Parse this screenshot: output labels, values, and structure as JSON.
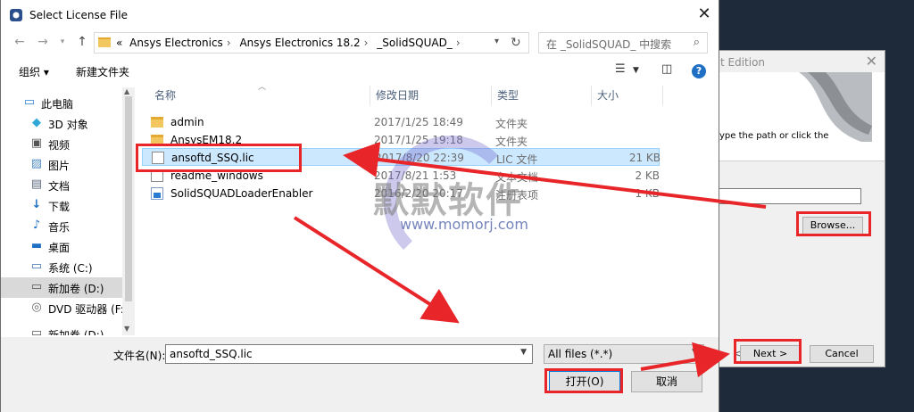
{
  "background_window": {
    "title": "t Edition",
    "instruction": "y type the path or click the",
    "browse_label": "Browse...",
    "back_glyph": "<",
    "next_label": "Next >",
    "cancel_label": "Cancel"
  },
  "dialog": {
    "title": "Select License File",
    "address": {
      "prefix": "«",
      "crumbs": [
        "Ansys Electronics",
        "Ansys Electronics 18.2",
        "_SolidSQUAD_"
      ]
    },
    "search_placeholder": "在 _SolidSQUAD_ 中搜索",
    "toolbar": {
      "organize": "组织 ▾",
      "new_folder": "新建文件夹"
    },
    "nav_tree": [
      {
        "label": "此电脑",
        "icon": "computer-icon",
        "glyph": "▭",
        "top": true
      },
      {
        "label": "3D 对象",
        "icon": "cube-icon",
        "glyph": "◆"
      },
      {
        "label": "视频",
        "icon": "video-icon",
        "glyph": "▣"
      },
      {
        "label": "图片",
        "icon": "picture-icon",
        "glyph": "▨"
      },
      {
        "label": "文档",
        "icon": "document-icon",
        "glyph": "▤"
      },
      {
        "label": "下载",
        "icon": "download-icon",
        "glyph": "↓"
      },
      {
        "label": "音乐",
        "icon": "music-icon",
        "glyph": "♪"
      },
      {
        "label": "桌面",
        "icon": "desktop-icon",
        "glyph": "▬"
      },
      {
        "label": "系统 (C:)",
        "icon": "drive-icon",
        "glyph": "▭"
      },
      {
        "label": "新加卷 (D:)",
        "icon": "drive-icon",
        "glyph": "▭",
        "selected": true
      },
      {
        "label": "DVD 驱动器 (F:)",
        "icon": "dvd-icon",
        "glyph": "◎"
      },
      {
        "label": "新加卷 (D:)",
        "icon": "drive-icon",
        "glyph": "▭"
      }
    ],
    "columns": [
      "名称",
      "修改日期",
      "类型",
      "大小"
    ],
    "files": [
      {
        "name": "admin",
        "date": "2017/1/25 18:49",
        "type": "文件夹",
        "size": "",
        "icon": "folder"
      },
      {
        "name": "AnsysEM18.2",
        "date": "2017/1/25 19:18",
        "type": "文件夹",
        "size": "",
        "icon": "folder"
      },
      {
        "name": "ansoftd_SSQ.lic",
        "date": "2017/8/20 22:39",
        "type": "LIC 文件",
        "size": "21 KB",
        "icon": "doc",
        "selected": true
      },
      {
        "name": "readme_windows",
        "date": "2017/8/21 1:53",
        "type": "文本文档",
        "size": "2 KB",
        "icon": "doc"
      },
      {
        "name": "SolidSQUADLoaderEnabler",
        "date": "2016/2/20 20:17",
        "type": "注册表项",
        "size": "1 KB",
        "icon": "exe"
      }
    ],
    "filename_label": "文件名(N):",
    "filename_value": "ansoftd_SSQ.lic",
    "filter_value": "All files (*.*)",
    "open_label": "打开(O)",
    "cancel_label": "取消"
  },
  "watermark": {
    "text": "默默软件",
    "url": "www.momorj.com"
  },
  "colors": {
    "annotation_red": "#e8262a",
    "selection": "#cce8ff",
    "accent": "#0078d7"
  }
}
